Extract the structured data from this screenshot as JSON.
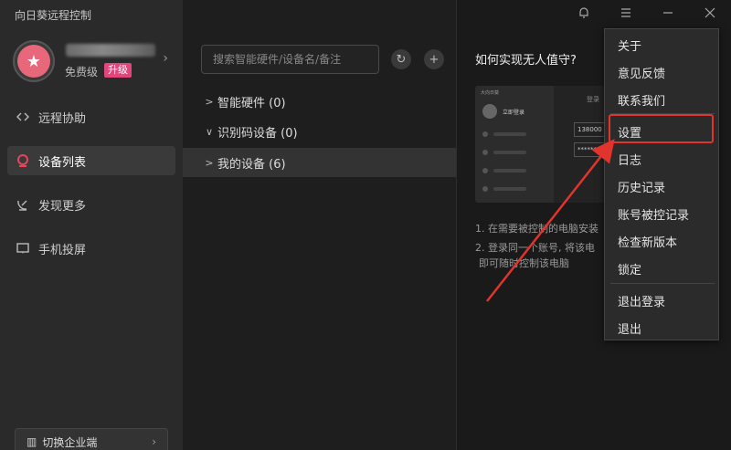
{
  "app": {
    "title": "向日葵远程控制"
  },
  "profile": {
    "tier": "免费级",
    "upgrade": "升级"
  },
  "nav": [
    {
      "label": "远程协助"
    },
    {
      "label": "设备列表"
    },
    {
      "label": "发现更多"
    },
    {
      "label": "手机投屏"
    }
  ],
  "enterprise": {
    "label": "切换企业端"
  },
  "search": {
    "placeholder": "搜索智能硬件/设备名/备注"
  },
  "tree": [
    {
      "label": "智能硬件 (0)"
    },
    {
      "label": "识别码设备 (0)"
    },
    {
      "label": "我的设备 (6)"
    }
  ],
  "help": {
    "title": "如何实现无人值守?",
    "step1": "1. 在需要被控制的电脑安装",
    "step2a": "2. 登录同一个账号, 将该电",
    "step2b": "即可随时控制该电脑",
    "illus_tiny": "大向日葵",
    "illus_user": "立即登录",
    "illus_title": "登录",
    "illus_phone": "138000",
    "illus_pwd": "********"
  },
  "menu": [
    {
      "label": "关于"
    },
    {
      "label": "意见反馈"
    },
    {
      "label": "联系我们"
    },
    {
      "label": "设置"
    },
    {
      "label": "日志"
    },
    {
      "label": "历史记录"
    },
    {
      "label": "账号被控记录"
    },
    {
      "label": "检查新版本"
    },
    {
      "label": "锁定"
    },
    {
      "label": "退出登录"
    },
    {
      "label": "退出"
    }
  ],
  "colors": {
    "accent": "#e0457b",
    "annotation": "#e0342c",
    "active_icon": "#e8445a"
  },
  "icons": {
    "bell": "bell-icon",
    "menu": "hamburger-icon",
    "minimize": "minimize-icon",
    "close": "close-icon",
    "refresh": "refresh-icon",
    "add": "plus-icon"
  }
}
